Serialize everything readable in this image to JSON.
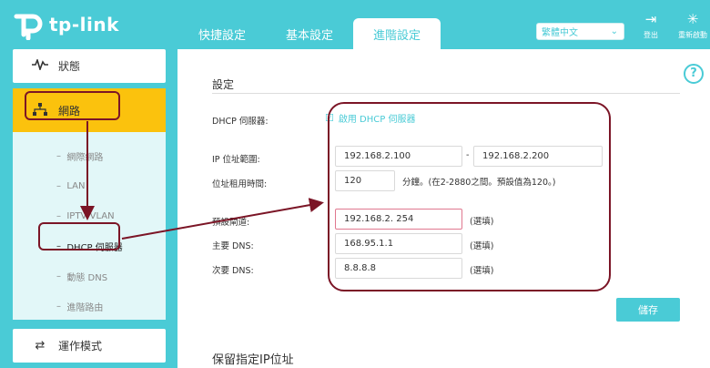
{
  "brand": {
    "name": "tp-link"
  },
  "header": {
    "tabs": [
      {
        "label": "快捷設定"
      },
      {
        "label": "基本設定"
      },
      {
        "label": "進階設定"
      }
    ],
    "language": {
      "selected": "繁體中文"
    },
    "logout_label": "登出",
    "reboot_label": "重新啟動"
  },
  "sidebar": {
    "items": [
      {
        "label": "狀態",
        "icon": "pulse-icon"
      },
      {
        "label": "網路",
        "icon": "network-icon"
      },
      {
        "label": "運作模式",
        "icon": "swap-icon"
      }
    ],
    "subitems": [
      {
        "label": "網際網路"
      },
      {
        "label": "LAN"
      },
      {
        "label": "IPTV/VLAN"
      },
      {
        "label": "DHCP 伺服器"
      },
      {
        "label": "動態 DNS"
      },
      {
        "label": "進階路由"
      }
    ]
  },
  "content": {
    "section_title": "設定",
    "dhcp_server_label": "DHCP 伺服器:",
    "enable_checkbox_label": "啟用 DHCP 伺服器",
    "ip_range_label": "IP 位址範圍:",
    "ip_start": "192.168.2.100",
    "ip_dash": "-",
    "ip_end": "192.168.2.200",
    "lease_label": "位址租用時間:",
    "lease_value": "120",
    "lease_note": "分鐘。(在2-2880之間。預設值為120。)",
    "gateway_label": "預設閘道:",
    "gateway_value": "192.168.2. 254",
    "gateway_note": "(選填)",
    "primary_dns_label": "主要 DNS:",
    "primary_dns_value": "168.95.1.1",
    "primary_dns_note": "(選填)",
    "secondary_dns_label": "次要 DNS:",
    "secondary_dns_value": "8.8.8.8",
    "secondary_dns_note": "(選填)",
    "save_label": "儲存",
    "section2_title": "保留指定IP位址"
  },
  "colors": {
    "brand_teal": "#4acbd6",
    "active_yellow": "#fbc20d",
    "annotation": "#7b1526"
  }
}
